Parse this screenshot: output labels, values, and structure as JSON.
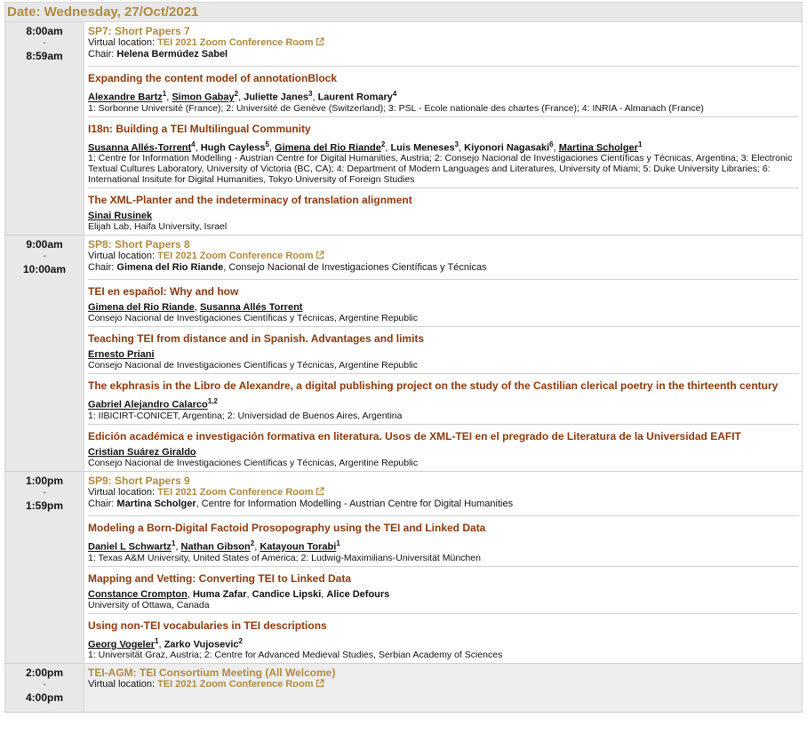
{
  "date_header": "Date: Wednesday, 27/Oct/2021",
  "virtual_location_label": "Virtual location:",
  "chair_label": "Chair:",
  "sessions": [
    {
      "time_start": "8:00am",
      "time_sep": "-",
      "time_end": "8:59am",
      "title": "SP7: Short Papers 7",
      "room": "TEI 2021 Zoom Conference Room",
      "chair_name": "Helena Bermúdez Sabel",
      "chair_affil": "",
      "papers": [
        {
          "title": "Expanding the content model of annotationBlock",
          "authors": [
            {
              "name": "Alexandre Bartz",
              "sup": "1",
              "sep": ", "
            },
            {
              "name": "Simon Gabay",
              "sup": "2",
              "sep": ", "
            },
            {
              "name": "Juliette Janes",
              "sup": "3",
              "sep": ", "
            },
            {
              "name": "Laurent Romary",
              "sup": "4",
              "sep": ""
            }
          ],
          "affiliation": "1: Sorbonne Université (France); 2: Université de Genève (Switzerland); 3: PSL - Ecole nationale des chartes (France); 4: INRIA - Almanach (France)"
        },
        {
          "title": "I18n: Building a TEI Multilingual Community",
          "authors": [
            {
              "name": "Susanna Allés-Torrent",
              "sup": "4",
              "sep": ", "
            },
            {
              "name": "Hugh Cayless",
              "sup": "5",
              "sep": ", "
            },
            {
              "name": "Gimena del Rio Riande",
              "sup": "2",
              "sep": ", "
            },
            {
              "name": "Luis Meneses",
              "sup": "3",
              "sep": ", "
            },
            {
              "name": "Kiyonori Nagasaki",
              "sup": "6",
              "sep": ", "
            },
            {
              "name": "Martina Scholger",
              "sup": "1",
              "sep": ""
            }
          ],
          "affiliation": "1: Centre for Information Modelling - Austrian Centre for Digital Humanities, Austria; 2: Consejo Nacional de Investigaciones Científicas y Técnicas, Argentina; 3: Electronic Textual Cultures Laboratory, University of Victoria (BC, CA); 4: Department of Modern Languages and Literatures, University of Miami; 5: Duke University Libraries; 6: International Insitute for Digital Humanities, Tokyo University of Foreign Studies"
        },
        {
          "title": "The XML-Planter and the indeterminacy of translation alignment",
          "authors": [
            {
              "name": "Sinai Rusinek",
              "sup": "",
              "sep": ""
            }
          ],
          "affiliation": "Elijah Lab, Haifa University, Israel"
        }
      ]
    },
    {
      "time_start": "9:00am",
      "time_sep": "-",
      "time_end": "10:00am",
      "title": "SP8: Short Papers 8",
      "room": "TEI 2021 Zoom Conference Room",
      "chair_name": "Gimena del Rio Riande",
      "chair_affil": ", Consejo Nacional de Investigaciones Científicas y Técnicas",
      "papers": [
        {
          "title": "TEI en español: Why and how",
          "authors": [
            {
              "name": "Gimena del Rio Riande",
              "sup": "",
              "sep": ", "
            },
            {
              "name": "Susanna Allés Torrent",
              "sup": "",
              "sep": ""
            }
          ],
          "affiliation": "Consejo Nacional de Investigaciones Científicas y Técnicas, Argentine Republic"
        },
        {
          "title": "Teaching TEI from distance and in Spanish. Advantages and limits",
          "authors": [
            {
              "name": "Ernesto Priani",
              "sup": "",
              "sep": ""
            }
          ],
          "affiliation": "Consejo Nacional de Investigaciones Científicas y Técnicas, Argentine Republic"
        },
        {
          "title": "The ekphrasis in the Libro de Alexandre, a digital publishing project on the study of the Castilian clerical poetry in the thirteenth century",
          "authors": [
            {
              "name": "Gabriel Alejandro Calarco",
              "sup": "1,2",
              "sep": ""
            }
          ],
          "affiliation": "1: IIBICIRT-CONICET, Argentina; 2: Universidad de Buenos Aires, Argentina"
        },
        {
          "title": "Edición académica e investigación formativa en literatura. Usos de XML-TEI en el pregrado de Literatura de la Universidad EAFIT",
          "authors": [
            {
              "name": "Cristian Suárez Giraldo",
              "sup": "",
              "sep": ""
            }
          ],
          "affiliation": "Consejo Nacional de Investigaciones Científicas y Técnicas, Argentine Republic"
        }
      ]
    },
    {
      "time_start": "1:00pm",
      "time_sep": "-",
      "time_end": "1:59pm",
      "title": "SP9: Short Papers 9",
      "room": "TEI 2021 Zoom Conference Room",
      "chair_name": "Martina Scholger",
      "chair_affil": ", Centre for Information Modelling - Austrian Centre for Digital Humanities",
      "papers": [
        {
          "title": "Modeling a Born-Digital Factoid Prosopography using the TEI and Linked Data",
          "authors": [
            {
              "name": "Daniel L Schwartz",
              "sup": "1",
              "sep": ", "
            },
            {
              "name": "Nathan Gibson",
              "sup": "2",
              "sep": ", "
            },
            {
              "name": "Katayoun Torabi",
              "sup": "1",
              "sep": ""
            }
          ],
          "affiliation": "1: Texas A&M University, United States of America; 2: Ludwig-Maximilians-Universität München"
        },
        {
          "title": "Mapping and Vetting: Converting TEI to Linked Data",
          "authors": [
            {
              "name": "Constance Crompton",
              "sup": "",
              "sep": ", "
            },
            {
              "name": "Huma Zafar",
              "sup": "",
              "sep": ", "
            },
            {
              "name": "Candice Lipski",
              "sup": "",
              "sep": ", "
            },
            {
              "name": "Alice Defours",
              "sup": "",
              "sep": ""
            }
          ],
          "affiliation": "University of Ottawa, Canada"
        },
        {
          "title": "Using non-TEI vocabularies in TEI descriptions",
          "authors": [
            {
              "name": "Georg Vogeler",
              "sup": "1",
              "sep": ", "
            },
            {
              "name": "Zarko Vujosevic",
              "sup": "2",
              "sep": ""
            }
          ],
          "affiliation": "1: Universität Graz, Austria; 2: Centre for Advanced Medieval Studies, Serbian Academy of Sciences"
        }
      ]
    }
  ],
  "agm": {
    "time_start": "2:00pm",
    "time_sep": "-",
    "time_end": "4:00pm",
    "title": "TEI-AGM: TEI Consortium Meeting (All Welcome)",
    "room": "TEI 2021 Zoom Conference Room"
  },
  "underlined_authors": [
    "Alexandre Bartz",
    "Simon Gabay",
    "Susanna Allés-Torrent",
    "Gimena del Rio Riande",
    "Martina Scholger",
    "Sinai Rusinek",
    "Susanna Allés Torrent",
    "Ernesto Priani",
    "Gabriel Alejandro Calarco",
    "Cristian Suárez Giraldo",
    "Daniel L Schwartz",
    "Nathan Gibson",
    "Katayoun Torabi",
    "Constance Crompton",
    "Georg Vogeler"
  ],
  "colors": {
    "session_title": "#b08a40",
    "paper_title": "#8b3a0e",
    "time_bg": "#e8e8e8"
  }
}
